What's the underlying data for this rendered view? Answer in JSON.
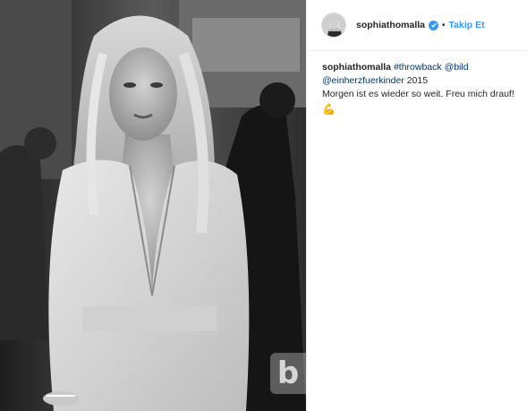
{
  "post": {
    "photo": {
      "watermark_text": "b"
    },
    "header": {
      "username": "sophiathomalla",
      "separator": "•",
      "follow_label": "Takip Et",
      "verified_color": "#3897f0",
      "icons": [
        "avatar",
        "verified-badge-icon"
      ]
    },
    "caption": {
      "username": "sophiathomalla",
      "hashtag": "#throwback",
      "mention_1": "@bild",
      "mention_2": "@einherzfuerkinder",
      "year_text": " 2015",
      "body_text": "Morgen ist es wieder so weit. Freu mich drauf!",
      "emoji": "💪"
    },
    "colors": {
      "link": "#003569",
      "follow": "#3897f0",
      "text": "#262626"
    }
  }
}
